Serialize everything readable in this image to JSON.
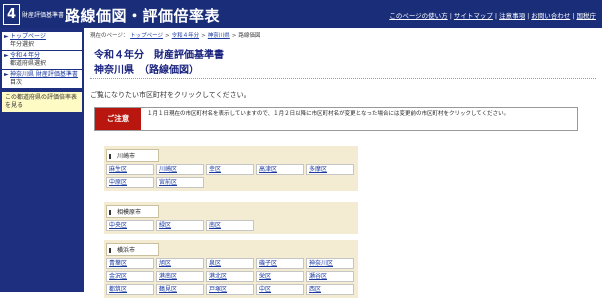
{
  "header": {
    "logo_number": "4",
    "logo_small": "財産評価基準書",
    "logo_big": "路線価図・評価倍率表",
    "links": [
      "このページの使い方",
      "サイトマップ",
      "注意事項",
      "お問い合わせ",
      "国税庁"
    ]
  },
  "sidebar": {
    "items": [
      {
        "link": "トップページ",
        "sub": "年分選択"
      },
      {
        "link": "令和４年分",
        "sub": "都道府県選択"
      },
      {
        "link": "神奈川県 財産評価基準書",
        "sub": "目次"
      }
    ],
    "note": "この都道府県の評価倍率表を見る"
  },
  "breadcrumb": {
    "prefix": "現在のページ：",
    "links": [
      "トップページ",
      "令和４年分",
      "神奈川県"
    ],
    "current": "路線価図"
  },
  "title": {
    "line1": "令和４年分　財産評価基準書",
    "line2": "神奈川県　（路線価図）"
  },
  "instruction": "ご覧になりたい市区町村をクリックしてください。",
  "notice": {
    "label": "ご注意",
    "text": "１月１日現在の市区町村名を表示していますので、１月２日以降に市区町村名が変更となった場合には変更前の市区町村をクリックしてください。"
  },
  "cities": [
    {
      "name": "川崎市",
      "wards": [
        "麻生区",
        "川崎区",
        "幸区",
        "高津区",
        "多摩区",
        "中原区",
        "宮前区"
      ]
    },
    {
      "name": "相模原市",
      "wards": [
        "中央区",
        "緑区",
        "南区"
      ]
    },
    {
      "name": "横浜市",
      "wards": [
        "青葉区",
        "旭区",
        "泉区",
        "磯子区",
        "神奈川区",
        "金沢区",
        "港南区",
        "港北区",
        "栄区",
        "瀬谷区",
        "都筑区",
        "鶴見区",
        "戸塚区",
        "中区",
        "西区"
      ]
    }
  ]
}
